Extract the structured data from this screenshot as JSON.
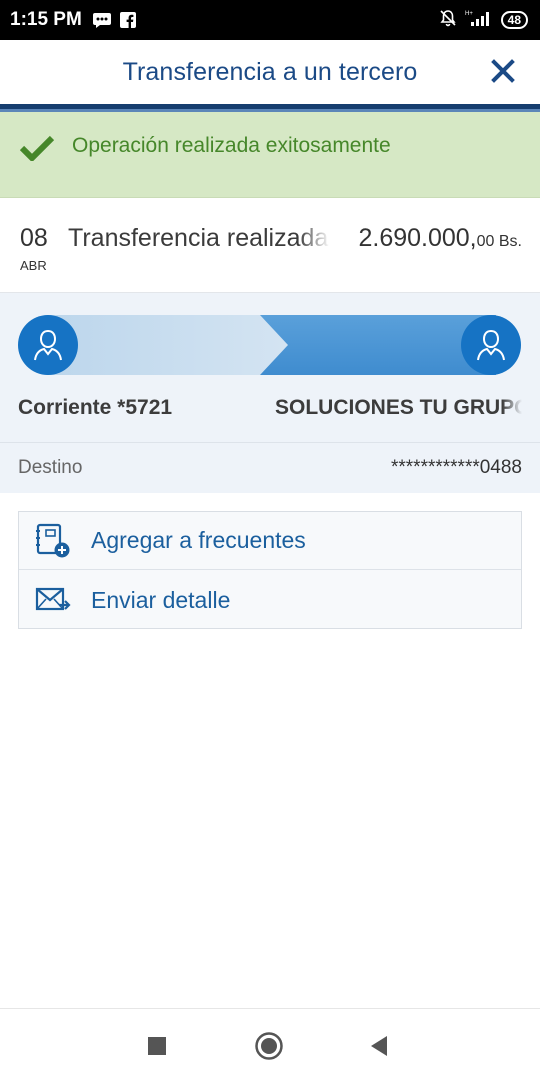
{
  "status_bar": {
    "time": "1:15 PM",
    "icons_left": [
      "message-icon",
      "facebook-icon"
    ],
    "icons_right": [
      "notifications-off-icon",
      "signal-icon"
    ],
    "battery": "48"
  },
  "header": {
    "title": "Transferencia a un tercero",
    "close_icon": "close-icon"
  },
  "banner": {
    "text": "Operación realizada exitosamente",
    "icon": "checkmark-icon",
    "color": "#46872a"
  },
  "transaction": {
    "day": "08",
    "month": "ABR",
    "description": "Transferencia realizada",
    "amount_main": "2.690.000,",
    "amount_cents": "00 Bs."
  },
  "flow": {
    "origin": "Corriente *5721",
    "destination": "SOLUCIONES TU GRUPO",
    "avatar_icon": "user-icon"
  },
  "destino": {
    "label": "Destino",
    "value": "************0488"
  },
  "actions": [
    {
      "label": "Agregar a frecuentes",
      "icon": "add-contact-book-icon"
    },
    {
      "label": "Enviar detalle",
      "icon": "send-mail-icon"
    }
  ],
  "nav": [
    "recent-apps-icon",
    "home-icon",
    "back-icon"
  ],
  "colors": {
    "brand_blue": "#1b4a86",
    "accent_blue": "#1673c4",
    "success_bg": "#d6e8c5"
  }
}
